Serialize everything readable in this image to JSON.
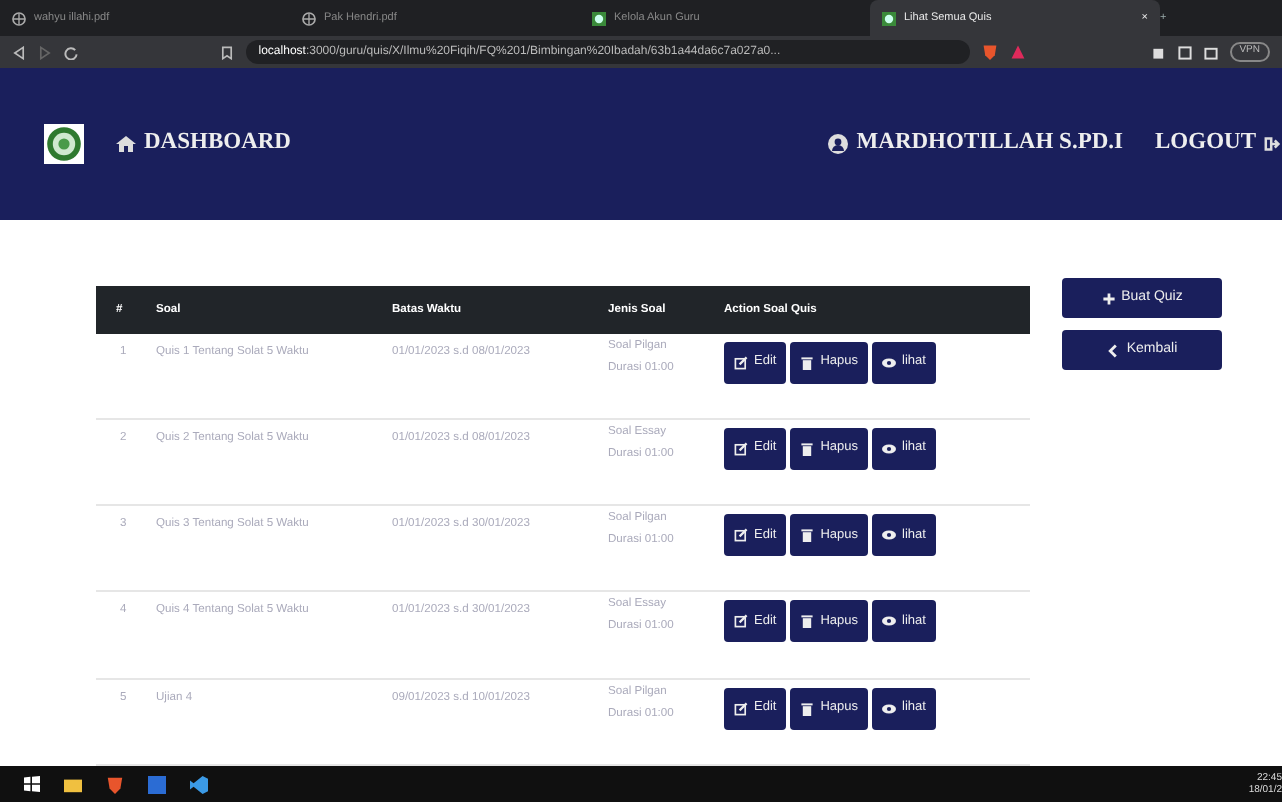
{
  "browser": {
    "tabs": [
      {
        "title": "wahyu illahi.pdf",
        "kind": "pdf",
        "selected": false
      },
      {
        "title": "Pak Hendri.pdf",
        "kind": "pdf",
        "selected": false
      },
      {
        "title": "Kelola Akun Guru",
        "kind": "site",
        "selected": false
      },
      {
        "title": "Lihat Semua Quis",
        "kind": "site",
        "selected": true
      }
    ],
    "close": "×",
    "new_tab": "+",
    "url_host": "localhost",
    "url_path": ":3000/guru/quis/X/Ilmu%20Fiqih/FQ%201/Bimbingan%20Ibadah/63b1a44da6c7a027a0...",
    "vpn": "VPN"
  },
  "navbar": {
    "brand": "DASHBOARD",
    "user": "MARDHOTILLAH S.PD.I",
    "logout": "LOGOUT"
  },
  "table": {
    "columns": [
      "#",
      "Soal",
      "Batas Waktu",
      "Jenis Soal",
      "Action Soal Quis"
    ],
    "rows": [
      {
        "no": "1",
        "soal": "Quis 1 Tentang Solat 5 Waktu",
        "batas": "01/01/2023 s.d 08/01/2023",
        "jenis": "Soal Pilgan",
        "durasi": "Durasi 01:00",
        "actions": [
          {
            "label": "Edit",
            "kind": "edit"
          },
          {
            "label": "Hapus",
            "kind": "delete"
          },
          {
            "label": "lihat",
            "kind": "view"
          }
        ]
      },
      {
        "no": "2",
        "soal": "Quis 2 Tentang Solat 5 Waktu",
        "batas": "01/01/2023 s.d 08/01/2023",
        "jenis": "Soal Essay",
        "durasi": "Durasi 01:00",
        "actions": [
          {
            "label": "Edit",
            "kind": "edit"
          },
          {
            "label": "Hapus",
            "kind": "delete"
          },
          {
            "label": "lihat",
            "kind": "view"
          }
        ]
      },
      {
        "no": "3",
        "soal": "Quis 3 Tentang Solat 5 Waktu",
        "batas": "01/01/2023 s.d 30/01/2023",
        "jenis": "Soal Pilgan",
        "durasi": "Durasi 01:00",
        "actions": [
          {
            "label": "Edit",
            "kind": "edit"
          },
          {
            "label": "Hapus",
            "kind": "delete"
          },
          {
            "label": "lihat",
            "kind": "view"
          }
        ]
      },
      {
        "no": "4",
        "soal": "Quis 4 Tentang Solat 5 Waktu",
        "batas": "01/01/2023 s.d 30/01/2023",
        "jenis": "Soal Essay",
        "durasi": "Durasi 01:00",
        "actions": [
          {
            "label": "Edit",
            "kind": "edit"
          },
          {
            "label": "Hapus",
            "kind": "delete"
          },
          {
            "label": "lihat",
            "kind": "view"
          }
        ]
      },
      {
        "no": "5",
        "soal": "Ujian 4",
        "batas": "09/01/2023 s.d 10/01/2023",
        "jenis": "Soal Pilgan",
        "durasi": "Durasi 01:00",
        "actions": [
          {
            "label": "Edit",
            "kind": "edit"
          },
          {
            "label": "Hapus",
            "kind": "delete"
          },
          {
            "label": "lihat",
            "kind": "view"
          }
        ]
      }
    ]
  },
  "side_buttons": [
    {
      "label": "Buat Quiz",
      "kind": "add"
    },
    {
      "label": "Kembali",
      "kind": "back"
    }
  ],
  "taskbar": {
    "time": "22:45",
    "date": "18/01/2"
  }
}
